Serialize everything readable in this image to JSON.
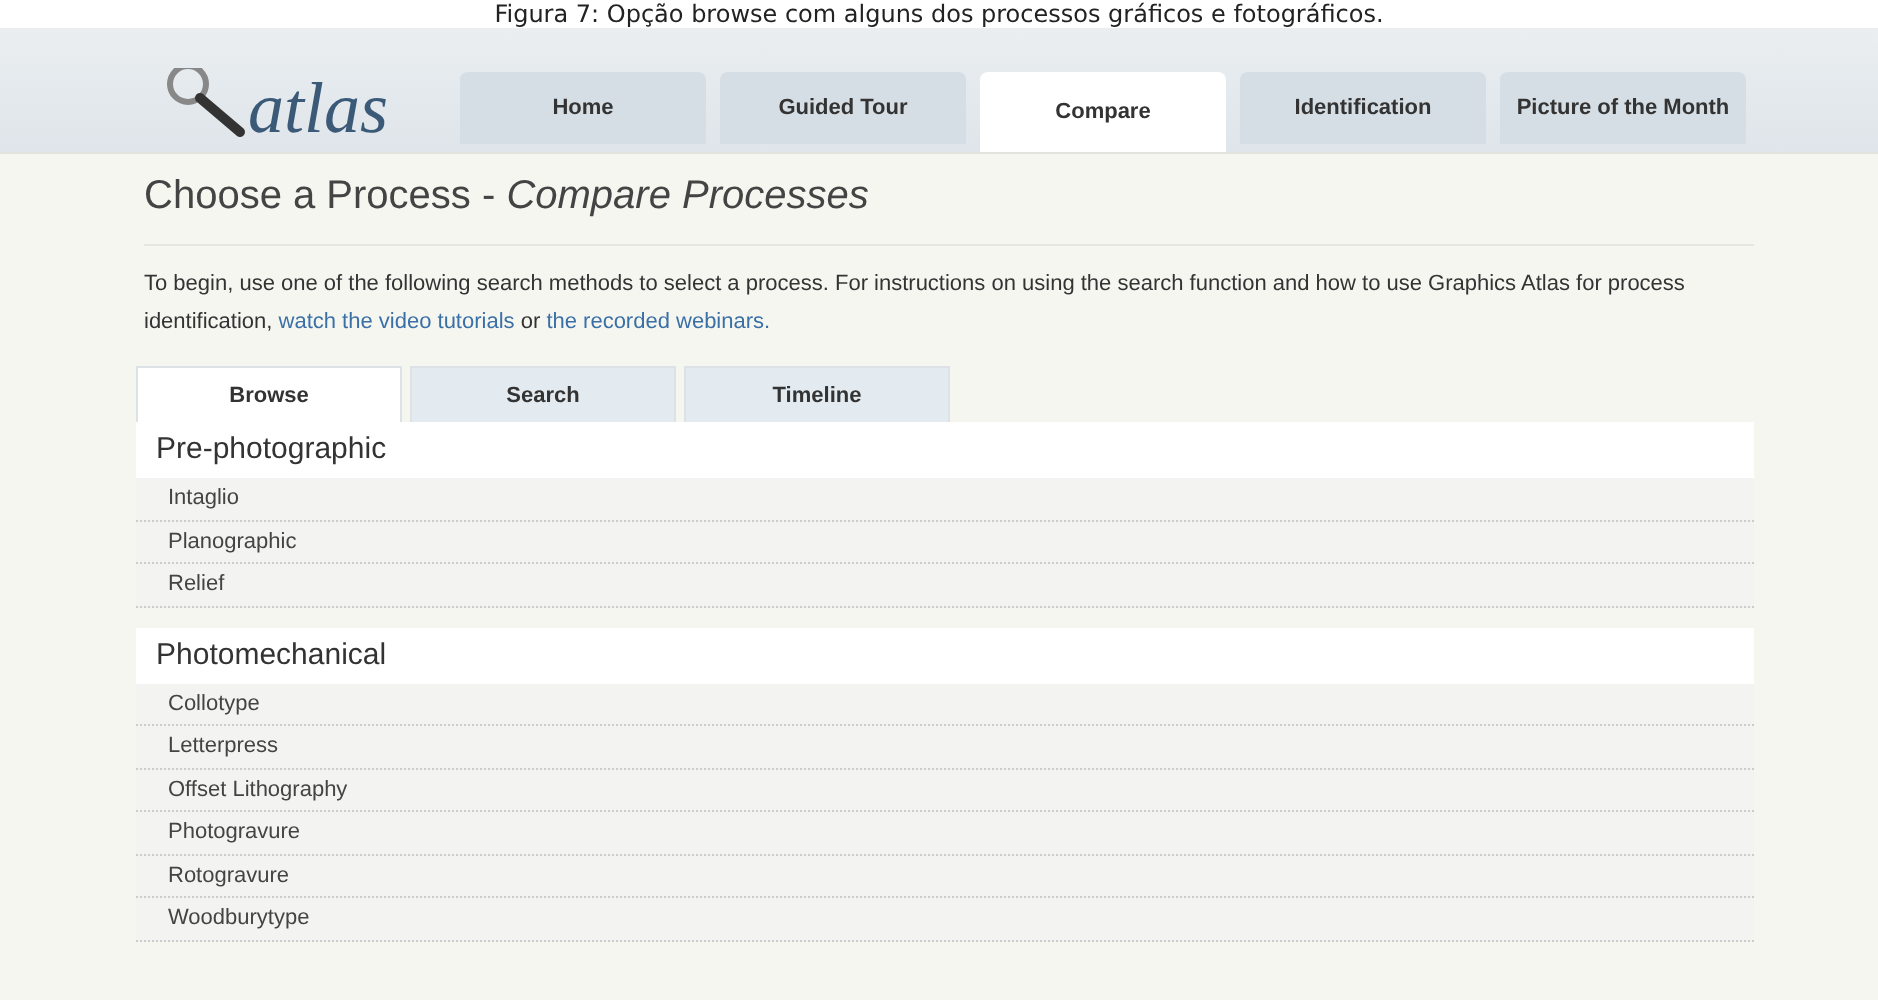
{
  "caption": "Figura 7: Opção browse com alguns dos processos gráficos e fotográficos.",
  "logo": {
    "text": "atlas"
  },
  "nav_tabs": [
    {
      "label": "Home",
      "selected": false
    },
    {
      "label": "Guided Tour",
      "selected": false
    },
    {
      "label": "Compare",
      "selected": true
    },
    {
      "label": "Identification",
      "selected": false
    },
    {
      "label": "Picture of the Month",
      "selected": false
    }
  ],
  "heading": {
    "main": "Choose a Process - ",
    "sub": "Compare Processes"
  },
  "intro": {
    "before": "To begin, use one of the following search methods to select a process. For instructions on using the search function and how to use Graphics Atlas for process identification, ",
    "link_1": "watch the video tutorials",
    "middle": " or ",
    "link_2": "the recorded webinars."
  },
  "browse_tabs": [
    {
      "label": "Browse",
      "selected": true
    },
    {
      "label": "Search",
      "selected": false
    },
    {
      "label": "Timeline",
      "selected": false
    }
  ],
  "categories": [
    {
      "title": "Pre-photographic",
      "items": [
        "Intaglio",
        "Planographic",
        "Relief"
      ]
    },
    {
      "title": "Photomechanical",
      "items": [
        "Collotype",
        "Letterpress",
        "Offset Lithography",
        "Photogravure",
        "Rotogravure",
        "Woodburytype"
      ]
    }
  ]
}
